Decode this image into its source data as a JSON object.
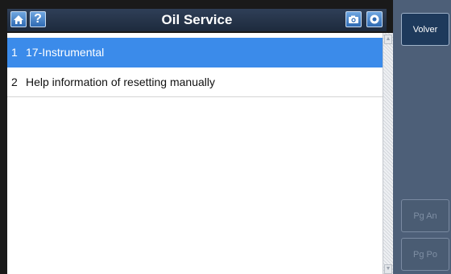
{
  "header": {
    "title": "Oil Service",
    "home_icon": "home-icon",
    "help_label": "?",
    "camera_icon": "camera-icon",
    "record_icon": "record-icon"
  },
  "list": {
    "items": [
      {
        "num": "1",
        "label": "17-Instrumental",
        "selected": true
      },
      {
        "num": "2",
        "label": "Help information of resetting manually",
        "selected": false
      }
    ]
  },
  "sidebar": {
    "back_label": "Volver",
    "page_up_label": "Pg An",
    "page_down_label": "Pg Po"
  },
  "colors": {
    "selection": "#3b8bea",
    "sidebar_bg": "#4d5f78",
    "title_bar": "#2f3f57"
  }
}
